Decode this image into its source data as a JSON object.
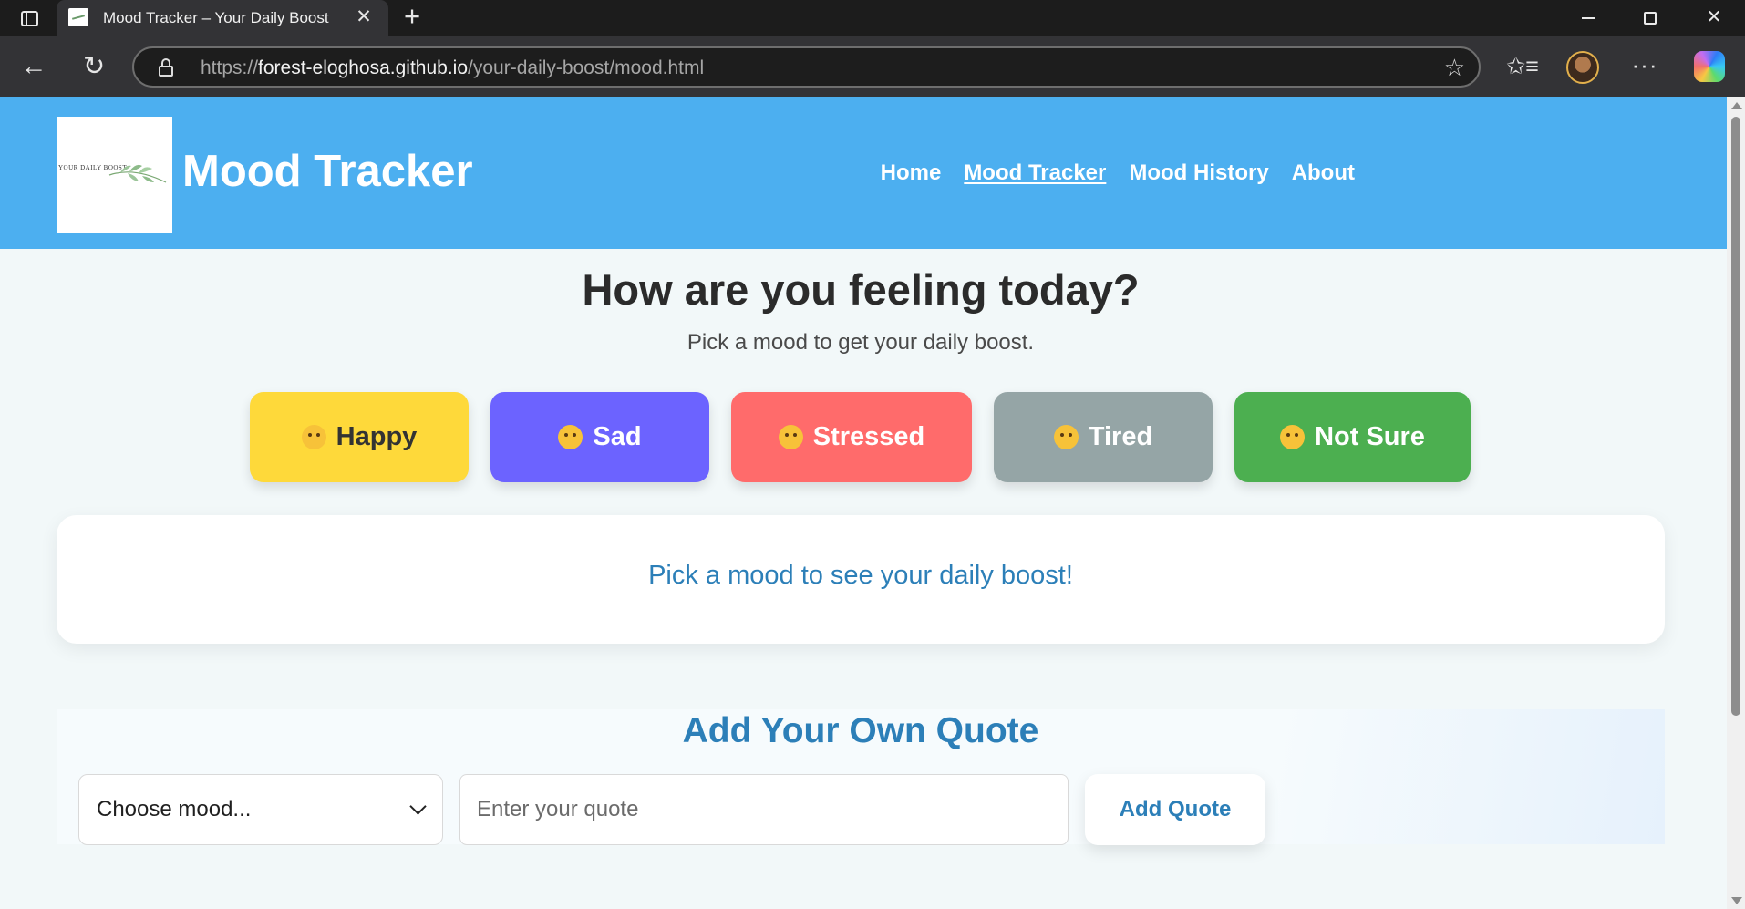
{
  "browser": {
    "tab_title": "Mood Tracker – Your Daily Boost",
    "url_scheme": "https://",
    "url_host": "forest-eloghosa.github.io",
    "url_path": "/your-daily-boost/mood.html",
    "icons": [
      "tab-actions-icon",
      "close-icon",
      "plus-icon",
      "minimize-icon",
      "maximize-icon",
      "close-icon",
      "back-icon",
      "reload-icon",
      "lock-icon",
      "star-icon",
      "favorites-icon",
      "avatar",
      "more-icon",
      "copilot-icon"
    ]
  },
  "header": {
    "logo_text": "YOUR DAILY BOOST",
    "title": "Mood Tracker",
    "nav": [
      {
        "label": "Home",
        "active": false
      },
      {
        "label": "Mood Tracker",
        "active": true
      },
      {
        "label": "Mood History",
        "active": false
      },
      {
        "label": "About",
        "active": false
      }
    ],
    "bg_color": "#4caff0"
  },
  "main": {
    "heading": "How are you feeling today?",
    "subheading": "Pick a mood to get your daily boost.",
    "moods": [
      {
        "label": "Happy",
        "emoji": "😊",
        "color": "#fed93a"
      },
      {
        "label": "Sad",
        "emoji": "😟",
        "color": "#6c63ff"
      },
      {
        "label": "Stressed",
        "emoji": "😩",
        "color": "#ff6b6b"
      },
      {
        "label": "Tired",
        "emoji": "😴",
        "color": "#95a5a6"
      },
      {
        "label": "Not Sure",
        "emoji": "🤔",
        "color": "#4caf50"
      }
    ],
    "boost_message": "Pick a mood to see your daily boost!"
  },
  "add_quote": {
    "heading": "Add Your Own Quote",
    "select_value": "Choose mood...",
    "input_placeholder": "Enter your quote",
    "button_label": "Add Quote",
    "accent_color": "#2c7fb8"
  }
}
